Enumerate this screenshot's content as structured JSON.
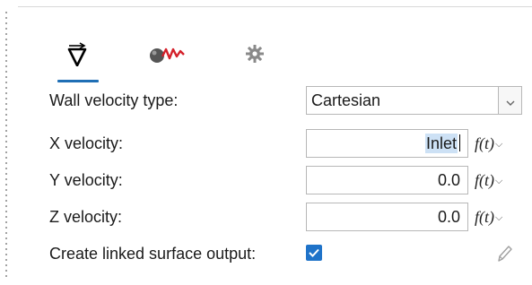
{
  "tabs": [
    {
      "icon": "nabla-velocity-icon",
      "active": true
    },
    {
      "icon": "wall-motion-icon",
      "active": false
    },
    {
      "icon": "settings-gear-icon",
      "active": false
    }
  ],
  "form": {
    "wall_velocity_type_label": "Wall velocity type:",
    "wall_velocity_type_value": "Cartesian",
    "x_velocity_label": "X velocity:",
    "x_velocity_value": "Inlet",
    "y_velocity_label": "Y velocity:",
    "y_velocity_value": "0.0",
    "z_velocity_label": "Z velocity:",
    "z_velocity_value": "0.0",
    "function_button_label": "f(t)",
    "create_linked_label": "Create linked surface output:",
    "create_linked_checked": true
  },
  "colors": {
    "accent": "#1f73c9",
    "selection": "#cde1f5"
  }
}
